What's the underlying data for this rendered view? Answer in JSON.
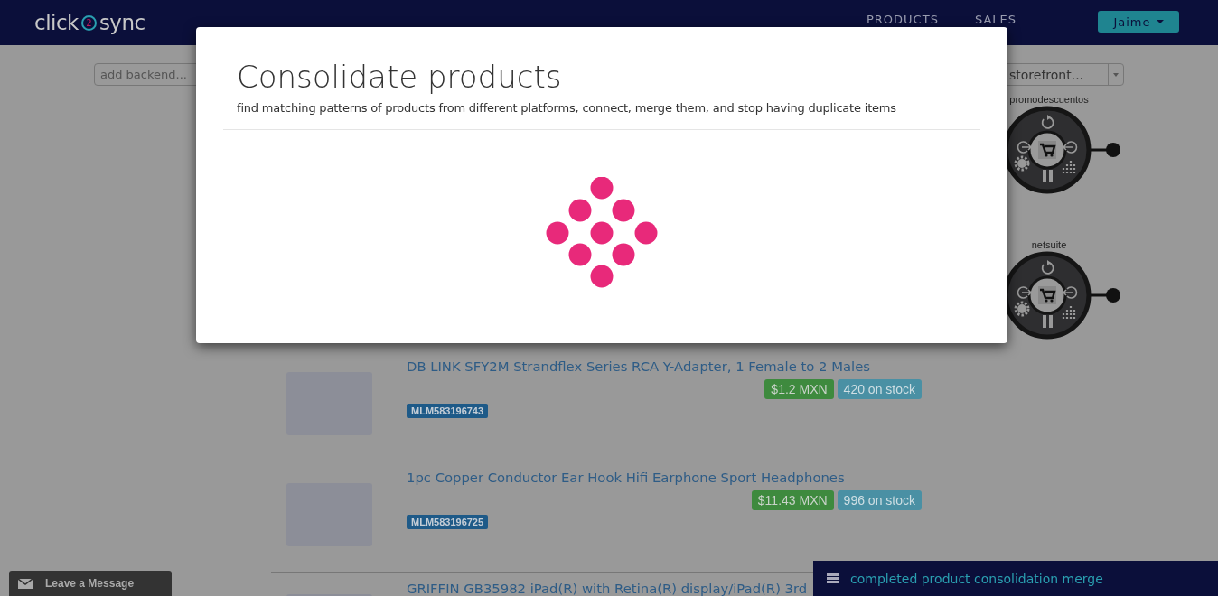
{
  "navbar": {
    "logo": {
      "left": "click",
      "middle": "2",
      "right": "sync"
    },
    "links": [
      {
        "label": "PRODUCTS"
      },
      {
        "label": "SALES"
      }
    ],
    "user_menu": {
      "label": "Jaime"
    }
  },
  "toolbar": {
    "backend_field": {
      "placeholder": "add backend..."
    },
    "storefront_select": {
      "value": "storefront..."
    }
  },
  "storefronts": [
    {
      "name": "promodescuentos"
    },
    {
      "name": "netsuite"
    }
  ],
  "products": [
    {
      "title": "DB LINK SFY2M Strandflex Series RCA Y-Adapter, 1 Female to 2 Males",
      "price": "$1.2 MXN",
      "stock": "420 on stock",
      "sku": "MLM583196743"
    },
    {
      "title": "1pc Copper Conductor Ear Hook Hifi Earphone Sport Headphones",
      "price": "$11.43 MXN",
      "stock": "996 on stock",
      "sku": "MLM583196725"
    },
    {
      "title": "GRIFFIN GB35982 iPad(R) with Retina(R) display/iPad(R) 3rd"
    }
  ],
  "modal": {
    "title": "Consolidate products",
    "subtitle": "find matching patterns of products from different platforms, connect, merge them, and stop having duplicate items"
  },
  "chat_tab": {
    "label": "Leave a Message"
  },
  "toast": {
    "message": "completed product consolidation merge"
  }
}
